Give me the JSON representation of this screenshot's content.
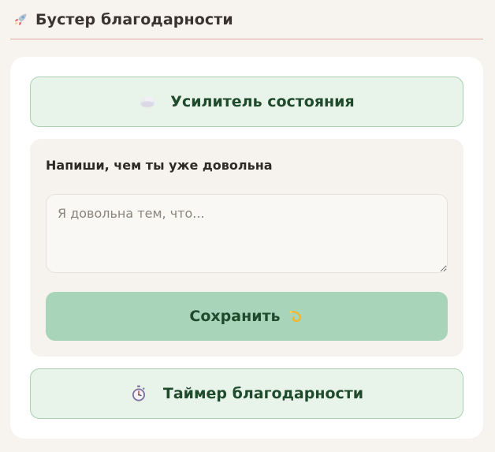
{
  "header": {
    "title": "Бустер благодарности",
    "icon": "rocket-icon"
  },
  "booster_button": {
    "label": "Усилитель состояния",
    "icon": "cloud-icon"
  },
  "gratitude_form": {
    "prompt": "Напиши, чем ты уже довольна",
    "input_placeholder": "Я довольна тем, что...",
    "input_value": "",
    "save_label": "Сохранить",
    "save_icon": "sparkle-swirl-icon"
  },
  "timer_button": {
    "label": "Таймер благодарности",
    "icon": "stopwatch-icon"
  },
  "colors": {
    "page_background": "#f7f3ee",
    "card_background": "#ffffff",
    "pill_background": "#e8f4e9",
    "pill_border": "#a9d2b1",
    "panel_background": "#f6f2ed",
    "save_button": "#a8d5b9",
    "accent_text": "#1f4a2c",
    "header_rule": "#e3aaa6"
  }
}
